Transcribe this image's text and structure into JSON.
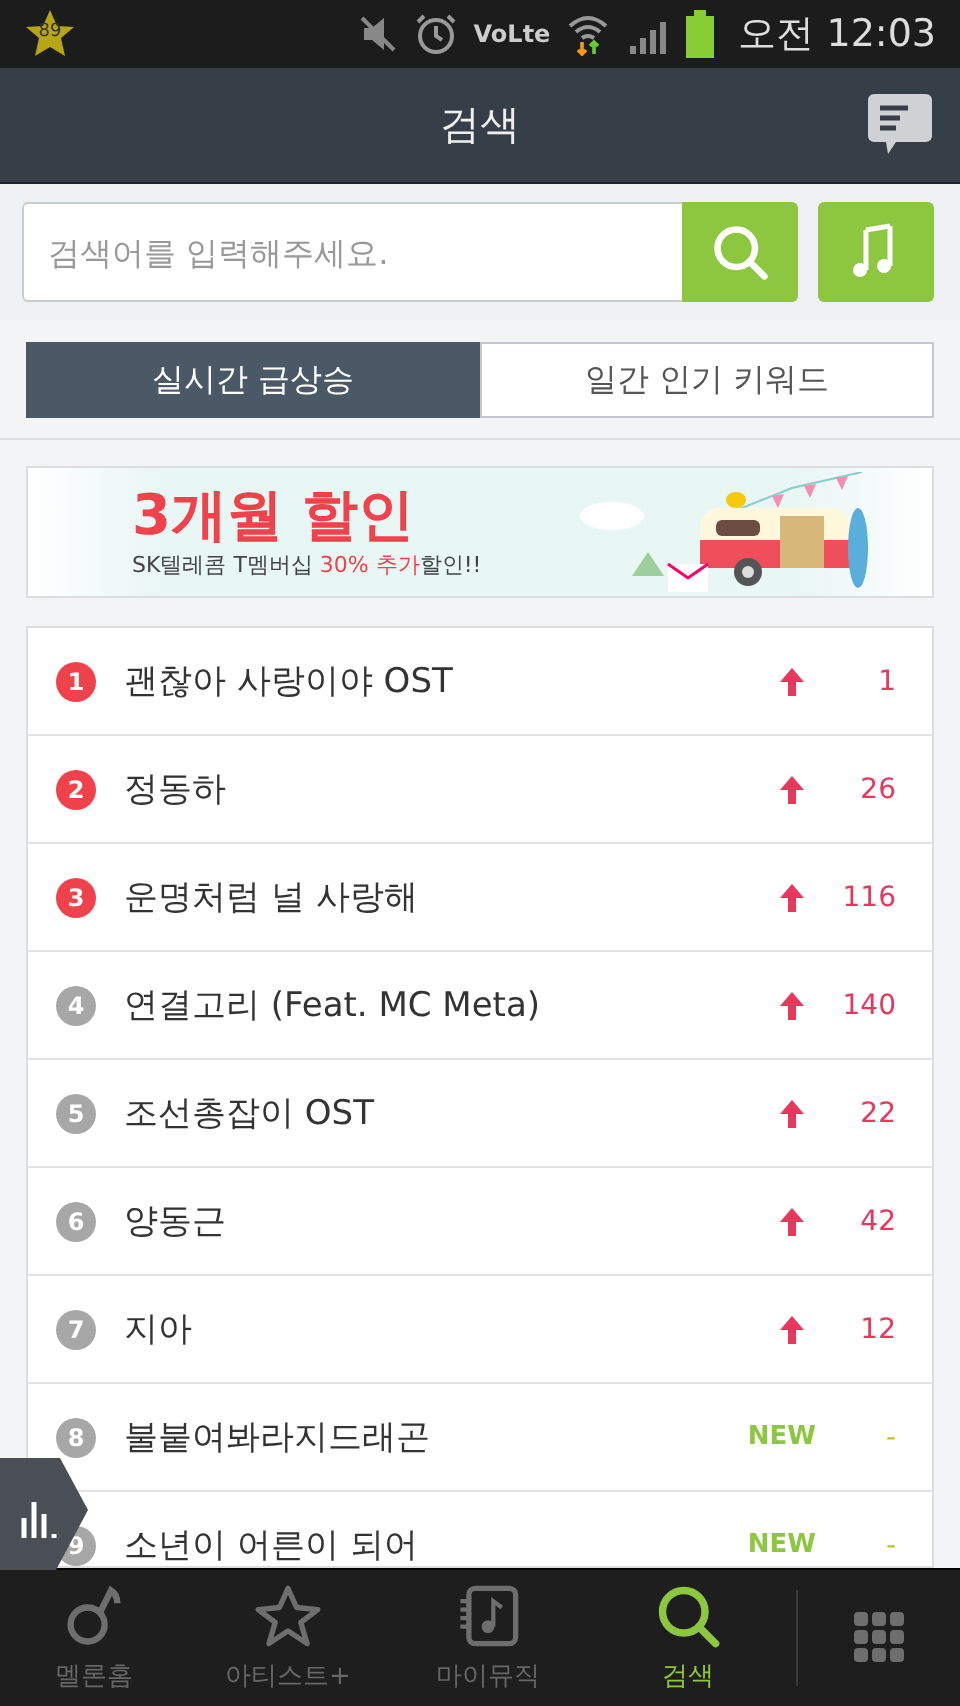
{
  "status_bar": {
    "notification_badge": "89",
    "network_label": "VoLte",
    "time": "오전 12:03"
  },
  "header": {
    "title": "검색"
  },
  "search": {
    "placeholder": "검색어를 입력해주세요."
  },
  "tabs": [
    {
      "label": "실시간 급상승",
      "selected": true
    },
    {
      "label": "일간 인기 키워드",
      "selected": false
    }
  ],
  "banner": {
    "headline": "3개월 할인",
    "subline": "SK텔레콤 T멤버십 **30% 추가**할인!!"
  },
  "keywords": [
    {
      "rank": "1",
      "color": "#f0424b",
      "title": "괜찮아 사랑이야 OST",
      "kind": "up",
      "change": "1"
    },
    {
      "rank": "2",
      "color": "#f0424b",
      "title": "정동하",
      "kind": "up",
      "change": "26"
    },
    {
      "rank": "3",
      "color": "#f0424b",
      "title": "운명처럼 널 사랑해",
      "kind": "up",
      "change": "116"
    },
    {
      "rank": "4",
      "color": "#a7a7a7",
      "title": "연결고리 (Feat. MC Meta)",
      "kind": "up",
      "change": "140"
    },
    {
      "rank": "5",
      "color": "#a7a7a7",
      "title": "조선총잡이 OST",
      "kind": "up",
      "change": "22"
    },
    {
      "rank": "6",
      "color": "#a7a7a7",
      "title": "양동근",
      "kind": "up",
      "change": "42"
    },
    {
      "rank": "7",
      "color": "#a7a7a7",
      "title": "지아",
      "kind": "up",
      "change": "12"
    },
    {
      "rank": "8",
      "color": "#a7a7a7",
      "title": "불붙여봐라지드래곤",
      "kind": "new",
      "badge": "NEW",
      "change": "-"
    },
    {
      "rank": "9",
      "color": "#a7a7a7",
      "title": "소년이 어른이 되어",
      "kind": "new",
      "badge": "NEW",
      "change": "-"
    }
  ],
  "bottom_nav": [
    {
      "label": "멜론홈",
      "selected": false
    },
    {
      "label": "아티스트+",
      "selected": false
    },
    {
      "label": "마이뮤직",
      "selected": false
    },
    {
      "label": "검색",
      "selected": true
    }
  ]
}
